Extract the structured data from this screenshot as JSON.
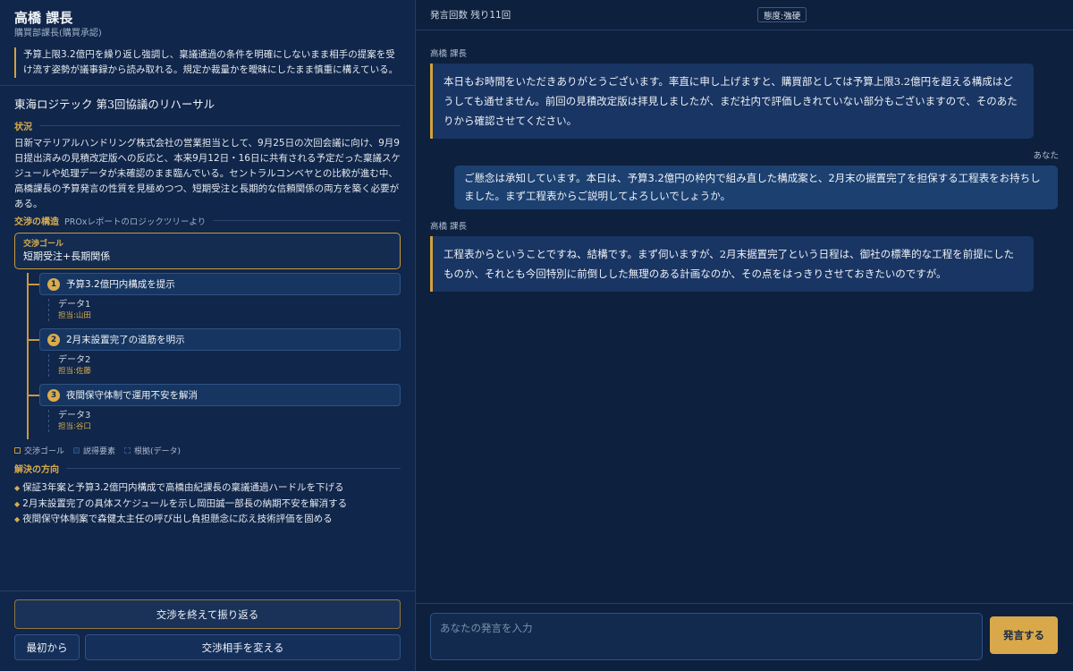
{
  "counterpart": {
    "name": "高橋 課長",
    "role": "購買部課長(購買承認)",
    "description": "予算上限3.2億円を繰り返し強調し、稟議通過の条件を明確にしないまま相手の提案を受け流す姿勢が議事録から読み取れる。規定か裁量かを曖昧にしたまま慎重に構えている。"
  },
  "scenario": {
    "title": "東海ロジテック 第3回協議のリハーサル",
    "situation_label": "状況",
    "situation": "日新マテリアルハンドリング株式会社の営業担当として、9月25日の次回会議に向け、9月9日提出済みの見積改定版への反応と、本来9月12日・16日に共有される予定だった稟議スケジュールや処理データが未確認のまま臨んでいる。セントラルコンベヤとの比較が進む中、高橋課長の予算発言の性質を見極めつつ、短期受注と長期的な信頼関係の両方を築く必要がある。",
    "structure_label": "交渉の構造",
    "structure_sub": "PROxレポートのロジックツリーより",
    "goal": {
      "label": "交渉ゴール",
      "text": "短期受注+長期関係"
    },
    "factors": [
      {
        "num": "1",
        "text": "予算3.2億円内構成を提示",
        "data": "データ1",
        "owner": "担当:山田"
      },
      {
        "num": "2",
        "text": "2月末設置完了の道筋を明示",
        "data": "データ2",
        "owner": "担当:佐藤"
      },
      {
        "num": "3",
        "text": "夜間保守体制で運用不安を解消",
        "data": "データ3",
        "owner": "担当:谷口"
      }
    ],
    "legend": {
      "goal": "交渉ゴール",
      "factor": "説得要素",
      "data": "根拠(データ)"
    },
    "direction_label": "解決の方向",
    "directions": [
      "保証3年案と予算3.2億円内構成で高橋由紀課長の稟議通過ハードルを下げる",
      "2月末設置完了の具体スケジュールを示し岡田誠一部長の納期不安を解消する",
      "夜間保守体制案で森健太主任の呼び出し負担懸念に応え技術評価を固める"
    ]
  },
  "footer_left": {
    "review_label": "交渉を終えて振り返る",
    "restart_label": "最初から",
    "change_label": "交渉相手を変える"
  },
  "chat_header": {
    "count": "発言回数 残り11回",
    "attitude": "態度:強硬"
  },
  "messages": [
    {
      "speaker": "高橋 課長",
      "side": "them",
      "text": "本日もお時間をいただきありがとうございます。率直に申し上げますと、購買部としては予算上限3.2億円を超える構成はどうしても通せません。前回の見積改定版は拝見しましたが、まだ社内で評価しきれていない部分もございますので、そのあたりから確認させてください。"
    },
    {
      "speaker": "あなた",
      "side": "you",
      "text": "ご懸念は承知しています。本日は、予算3.2億円の枠内で組み直した構成案と、2月末の据置完了を担保する工程表をお持ちしました。まず工程表からご説明してよろしいでしょうか。"
    },
    {
      "speaker": "高橋 課長",
      "side": "them",
      "text": "工程表からということですね、結構です。まず伺いますが、2月末据置完了という日程は、御社の標準的な工程を前提にしたものか、それとも今回特別に前倒しした無理のある計画なのか、その点をはっきりさせておきたいのですが。"
    }
  ],
  "composer": {
    "placeholder": "あなたの発言を入力",
    "send_label": "発言する"
  }
}
